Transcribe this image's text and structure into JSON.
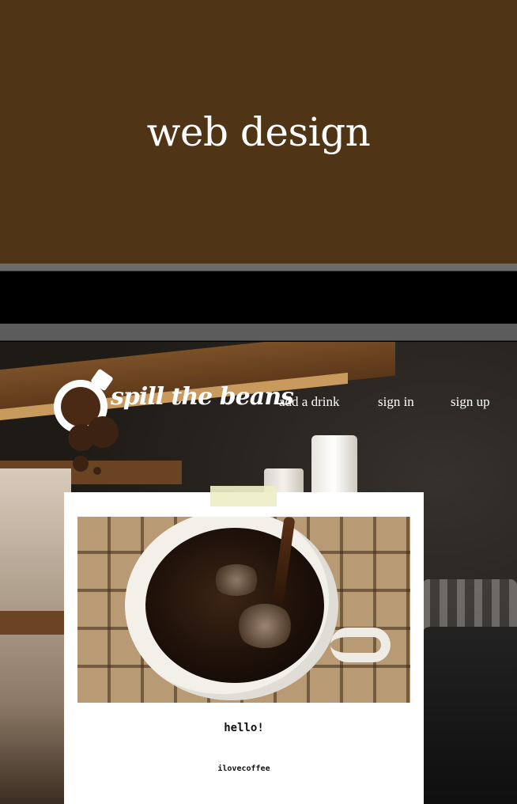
{
  "header": {
    "title": "web design"
  },
  "site": {
    "name": "spill the beans",
    "nav": [
      {
        "label": "add a drink"
      },
      {
        "label": "sign in"
      },
      {
        "label": "sign up"
      }
    ]
  },
  "post": {
    "title": "hello!",
    "author": "ilovecoffee"
  },
  "colors": {
    "header_background": "#4f3415",
    "text_light": "#ffffff",
    "card_background": "#ffffff",
    "tape": "#eeeec8"
  }
}
